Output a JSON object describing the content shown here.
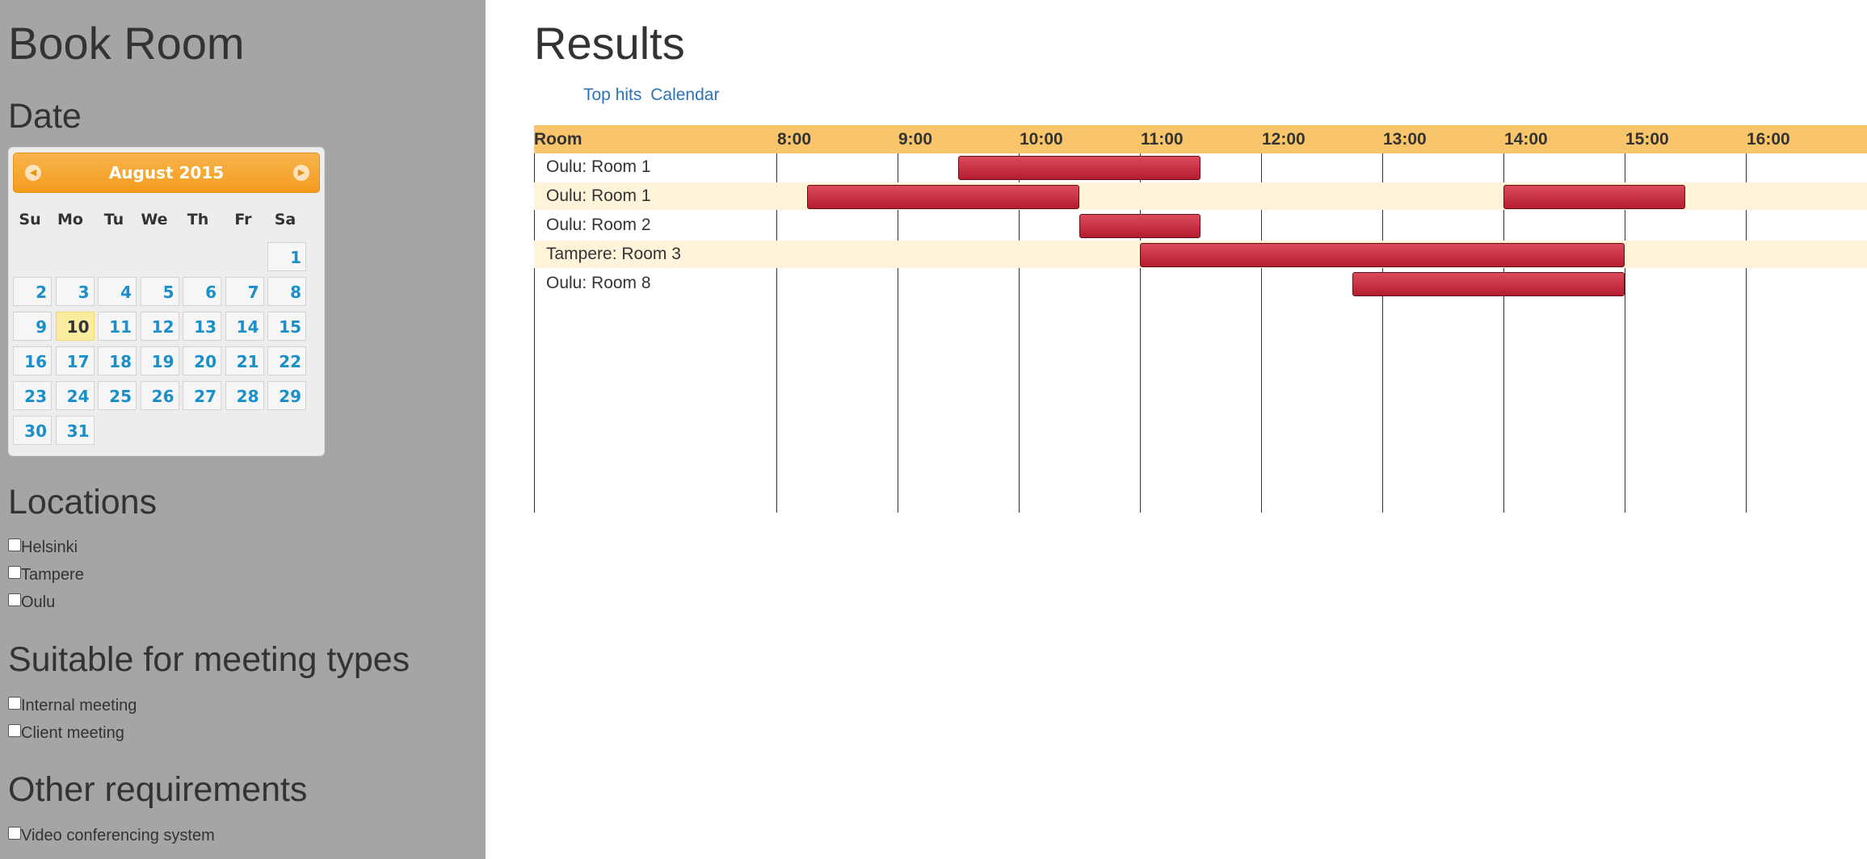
{
  "sidebar": {
    "title": "Book Room",
    "date_heading": "Date",
    "calendar": {
      "month_label": "August 2015",
      "prev_icon": "◀",
      "next_icon": "▶",
      "weekdays": [
        "Su",
        "Mo",
        "Tu",
        "We",
        "Th",
        "Fr",
        "Sa"
      ],
      "days": [
        "1",
        "2",
        "3",
        "4",
        "5",
        "6",
        "7",
        "8",
        "9",
        "10",
        "11",
        "12",
        "13",
        "14",
        "15",
        "16",
        "17",
        "18",
        "19",
        "20",
        "21",
        "22",
        "23",
        "24",
        "25",
        "26",
        "27",
        "28",
        "29",
        "30",
        "31"
      ],
      "today": "10"
    },
    "locations_heading": "Locations",
    "locations": [
      {
        "label": "Helsinki",
        "checked": false
      },
      {
        "label": "Tampere",
        "checked": false
      },
      {
        "label": "Oulu",
        "checked": false
      }
    ],
    "meeting_types_heading": "Suitable for meeting types",
    "meeting_types": [
      {
        "label": "Internal meeting",
        "checked": false
      },
      {
        "label": "Client meeting",
        "checked": false
      }
    ],
    "other_heading": "Other requirements",
    "other": [
      {
        "label": "Video conferencing system",
        "checked": false
      }
    ]
  },
  "main": {
    "title": "Results",
    "tabs": [
      "Top hits",
      "Calendar"
    ],
    "gantt": {
      "room_header": "Room",
      "hours": [
        "8:00",
        "9:00",
        "10:00",
        "11:00",
        "12:00",
        "13:00",
        "14:00",
        "15:00",
        "16:00"
      ],
      "rows": [
        {
          "room": "Oulu: Room 1",
          "bookings": [
            {
              "start": "9:30",
              "end": "11:30"
            }
          ]
        },
        {
          "room": "Oulu: Room 1",
          "bookings": [
            {
              "start": "8:15",
              "end": "10:30"
            },
            {
              "start": "14:00",
              "end": "15:30"
            }
          ]
        },
        {
          "room": "Oulu: Room 2",
          "bookings": [
            {
              "start": "10:30",
              "end": "11:30"
            }
          ]
        },
        {
          "room": "Tampere: Room 3",
          "bookings": [
            {
              "start": "11:00",
              "end": "15:00"
            }
          ]
        },
        {
          "room": "Oulu: Room 8",
          "bookings": [
            {
              "start": "12:45",
              "end": "15:00"
            }
          ]
        }
      ]
    },
    "colors": {
      "header_bg": "#f8c56b",
      "alt_row_bg": "#fff3da",
      "bar": "#c52a3e"
    }
  }
}
